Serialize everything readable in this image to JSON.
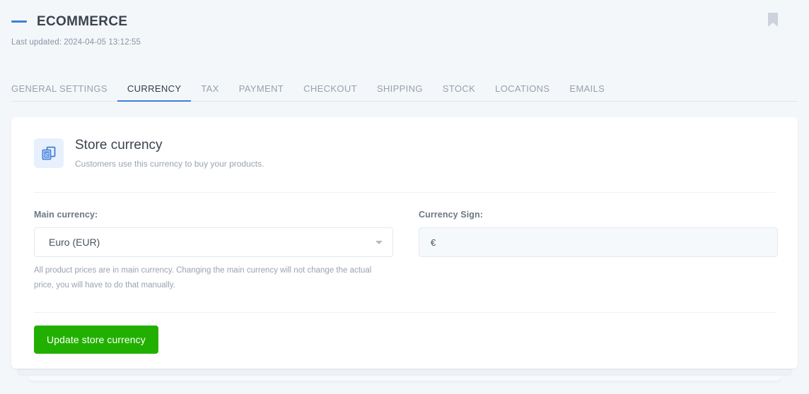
{
  "header": {
    "title": "ECOMMERCE",
    "last_updated": "Last updated: 2024-04-05 13:12:55",
    "bookmark_icon": "bookmark-icon",
    "accent_color": "#3f7fdb"
  },
  "tabs": [
    {
      "label": "GENERAL SETTINGS",
      "active": false
    },
    {
      "label": "CURRENCY",
      "active": true
    },
    {
      "label": "TAX",
      "active": false
    },
    {
      "label": "PAYMENT",
      "active": false
    },
    {
      "label": "CHECKOUT",
      "active": false
    },
    {
      "label": "SHIPPING",
      "active": false
    },
    {
      "label": "STOCK",
      "active": false
    },
    {
      "label": "LOCATIONS",
      "active": false
    },
    {
      "label": "EMAILS",
      "active": false
    }
  ],
  "card": {
    "icon": "money-documents-icon",
    "title": "Store currency",
    "subtitle": "Customers use this currency to buy your products.",
    "main_currency": {
      "label": "Main currency:",
      "value": "Euro (EUR)",
      "options": [
        "Euro (EUR)"
      ],
      "help": "All product prices are in main currency. Changing the main currency will not change the actual price, you will have to do that manually."
    },
    "currency_sign": {
      "label": "Currency Sign:",
      "value": "€",
      "placeholder": ""
    },
    "submit_label": "Update store currency",
    "submit_color": "#22b000"
  }
}
